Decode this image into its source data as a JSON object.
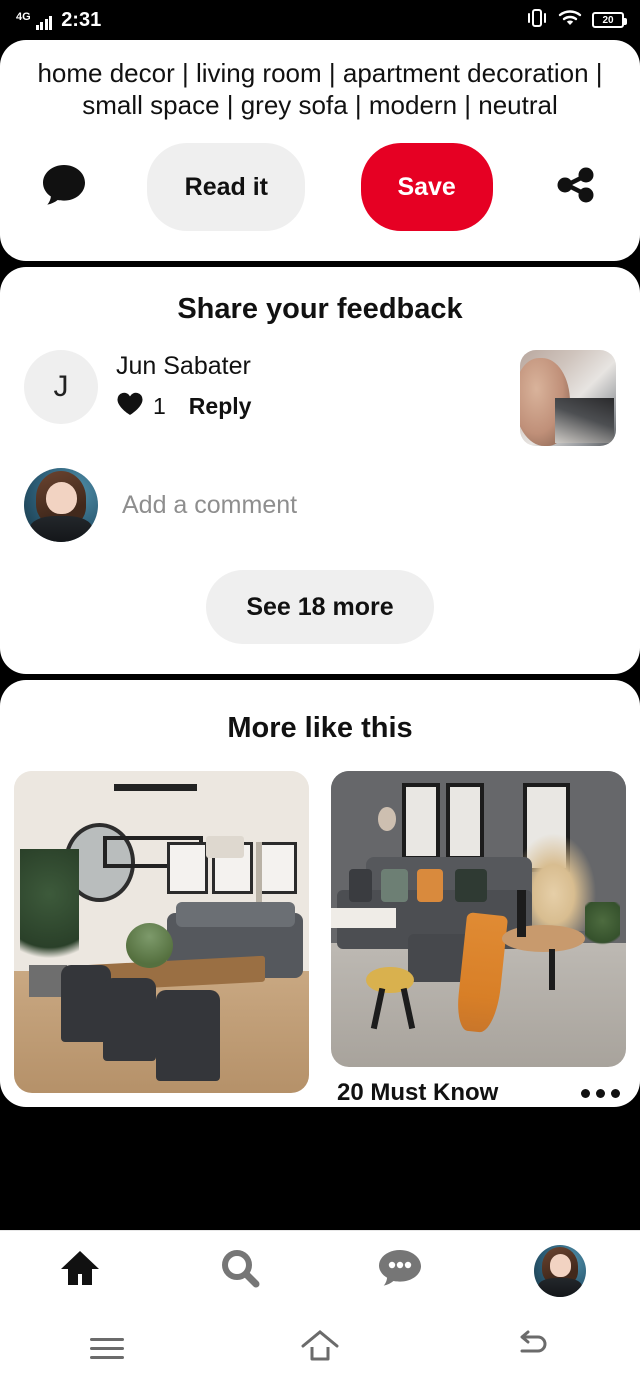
{
  "status_bar": {
    "network": "4G",
    "time": "2:31",
    "battery_level": "20",
    "icons": [
      "signal-bars-icon",
      "vibrate-icon",
      "wifi-icon",
      "battery-icon"
    ]
  },
  "pin_detail": {
    "tagline": "home decor | living room | apartment decoration | small space | grey sofa | modern | neutral",
    "actions": {
      "comment_icon": "comment-bubble-icon",
      "read_it_label": "Read it",
      "save_label": "Save",
      "share_icon": "share-icon",
      "save_color": "#e60023",
      "secondary_color": "#efefef"
    }
  },
  "feedback": {
    "title": "Share your feedback",
    "comment": {
      "avatar_initial": "J",
      "author": "Jun Sabater",
      "like_icon": "heart-icon",
      "like_count": "1",
      "reply_label": "Reply",
      "attachment": "photo-thumbnail"
    },
    "add_comment_placeholder": "Add a comment",
    "see_more_label": "See 18 more"
  },
  "more_like_this": {
    "title": "More like this",
    "pins": [
      {
        "alt": "modern dining room with wooden table, black chairs and grey sofa",
        "caption": ""
      },
      {
        "alt": "grey sectional sofa living room with orange throw and pampas grass",
        "caption": "20 Must Know",
        "overflow_icon": "more-options-icon"
      }
    ]
  },
  "app_nav": {
    "items": [
      {
        "name": "home",
        "icon": "home-icon",
        "active": true
      },
      {
        "name": "search",
        "icon": "search-icon",
        "active": false
      },
      {
        "name": "messages",
        "icon": "chat-bubble-icon",
        "active": false
      },
      {
        "name": "profile",
        "icon": "profile-avatar",
        "active": false
      }
    ]
  },
  "system_nav": {
    "items": [
      {
        "name": "recents",
        "icon": "recents-icon"
      },
      {
        "name": "home",
        "icon": "home-outline-icon"
      },
      {
        "name": "back",
        "icon": "back-icon"
      }
    ]
  }
}
